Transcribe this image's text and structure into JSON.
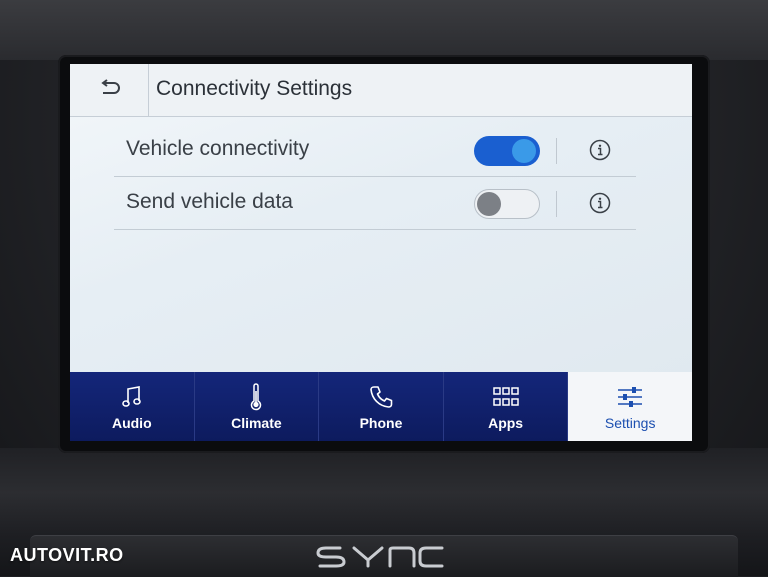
{
  "header": {
    "title": "Connectivity Settings",
    "back_icon": "back-arrow-icon"
  },
  "settings": [
    {
      "label": "Vehicle connectivity",
      "enabled": true,
      "info_icon": "info-icon"
    },
    {
      "label": "Send vehicle data",
      "enabled": false,
      "info_icon": "info-icon"
    }
  ],
  "nav": {
    "items": [
      {
        "label": "Audio",
        "icon": "music-note-icon",
        "active": false
      },
      {
        "label": "Climate",
        "icon": "thermometer-icon",
        "active": false
      },
      {
        "label": "Phone",
        "icon": "phone-icon",
        "active": false
      },
      {
        "label": "Apps",
        "icon": "apps-grid-icon",
        "active": false
      },
      {
        "label": "Settings",
        "icon": "sliders-icon",
        "active": true
      }
    ]
  },
  "branding": {
    "logo": "SYNC",
    "watermark": "AUTOVIT.RO"
  },
  "colors": {
    "toggle_on": "#1a5fd0",
    "nav_bg": "#10206a",
    "nav_active_text": "#1c4fb0"
  }
}
